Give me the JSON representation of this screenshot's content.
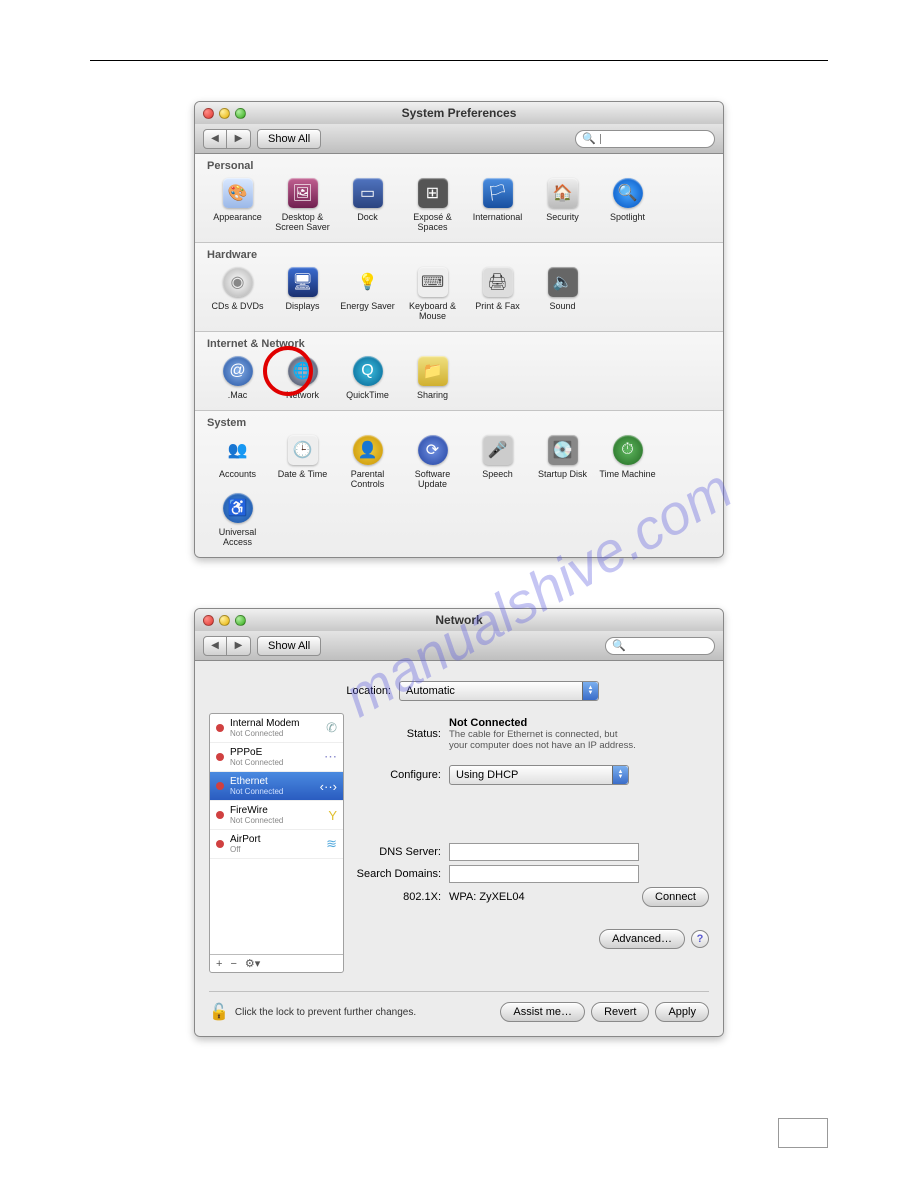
{
  "watermark": "manualshive.com",
  "win1": {
    "title": "System Preferences",
    "show_all": "Show All",
    "search_placeholder": "",
    "sections": {
      "personal": {
        "heading": "Personal",
        "items": [
          {
            "label": "Appearance"
          },
          {
            "label": "Desktop & Screen Saver"
          },
          {
            "label": "Dock"
          },
          {
            "label": "Exposé & Spaces"
          },
          {
            "label": "International"
          },
          {
            "label": "Security"
          },
          {
            "label": "Spotlight"
          }
        ]
      },
      "hardware": {
        "heading": "Hardware",
        "items": [
          {
            "label": "CDs & DVDs"
          },
          {
            "label": "Displays"
          },
          {
            "label": "Energy Saver"
          },
          {
            "label": "Keyboard & Mouse"
          },
          {
            "label": "Print & Fax"
          },
          {
            "label": "Sound"
          }
        ]
      },
      "internet": {
        "heading": "Internet & Network",
        "items": [
          {
            "label": ".Mac"
          },
          {
            "label": "Network"
          },
          {
            "label": "QuickTime"
          },
          {
            "label": "Sharing"
          }
        ]
      },
      "system": {
        "heading": "System",
        "items": [
          {
            "label": "Accounts"
          },
          {
            "label": "Date & Time"
          },
          {
            "label": "Parental Controls"
          },
          {
            "label": "Software Update"
          },
          {
            "label": "Speech"
          },
          {
            "label": "Startup Disk"
          },
          {
            "label": "Time Machine"
          },
          {
            "label": "Universal Access"
          }
        ]
      }
    }
  },
  "win2": {
    "title": "Network",
    "show_all": "Show All",
    "location_label": "Location:",
    "location_value": "Automatic",
    "services": [
      {
        "name": "Internal Modem",
        "status": "Not Connected"
      },
      {
        "name": "PPPoE",
        "status": "Not Connected"
      },
      {
        "name": "Ethernet",
        "status": "Not Connected"
      },
      {
        "name": "FireWire",
        "status": "Not Connected"
      },
      {
        "name": "AirPort",
        "status": "Off"
      }
    ],
    "status_label": "Status:",
    "status_value": "Not Connected",
    "status_hint1": "The cable for Ethernet is connected, but",
    "status_hint2": "your computer does not have an IP address.",
    "configure_label": "Configure:",
    "configure_value": "Using DHCP",
    "dns_label": "DNS Server:",
    "search_domains_label": "Search Domains:",
    "x8021_label": "802.1X:",
    "x8021_value": "WPA: ZyXEL04",
    "connect": "Connect",
    "advanced": "Advanced…",
    "lock_text": "Click the lock to prevent further changes.",
    "assist": "Assist me…",
    "revert": "Revert",
    "apply": "Apply"
  }
}
